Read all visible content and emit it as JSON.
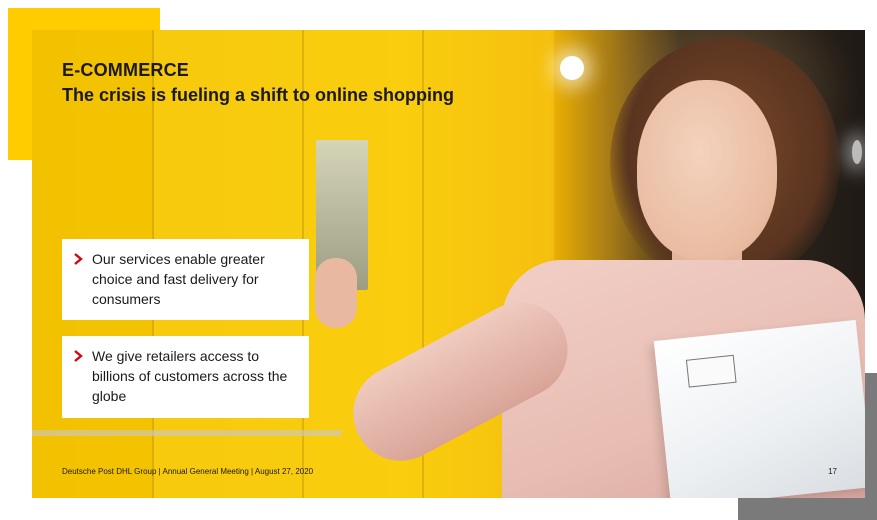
{
  "slide": {
    "heading": "E-COMMERCE",
    "subheading": "The crisis is fueling a shift to online shopping",
    "bullets": [
      {
        "icon": "chevron-right-icon",
        "text": "Our services enable greater choice and fast delivery for consumers"
      },
      {
        "icon": "chevron-right-icon",
        "text": "We give retailers access to billions of customers across the globe"
      }
    ],
    "footer": "Deutsche Post DHL Group | Annual General Meeting | August 27, 2020",
    "page_number": "17"
  },
  "colors": {
    "brand_yellow": "#ffcc00",
    "accent_red": "#d40511",
    "deco_gray": "#7a7a7a"
  }
}
